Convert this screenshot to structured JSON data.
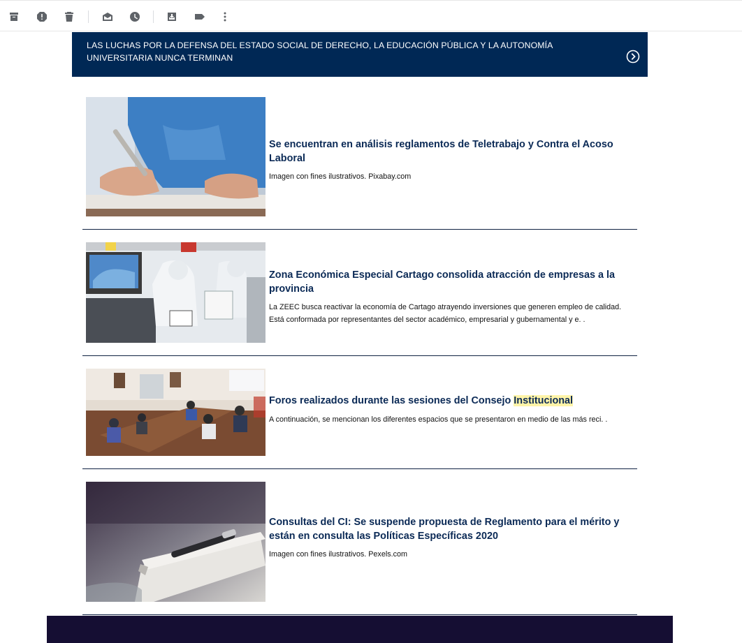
{
  "toolbar": {
    "buttons": [
      {
        "name": "archive-icon"
      },
      {
        "name": "report-spam-icon"
      },
      {
        "name": "delete-icon"
      },
      {
        "name": "mark-unread-icon"
      },
      {
        "name": "snooze-icon"
      },
      {
        "name": "move-to-icon"
      },
      {
        "name": "label-icon"
      },
      {
        "name": "more-options-icon"
      }
    ]
  },
  "banner": {
    "text": "LAS LUCHAS POR LA DEFENSA DEL ESTADO SOCIAL DE DERECHO, LA EDUCACIÓN PÚBLICA Y LA AUTONOMÍA UNIVERSITARIA NUNCA TERMINAN",
    "background": "#002855"
  },
  "articles": [
    {
      "title": "Se encuentran en análisis reglamentos de Teletrabajo y Contra el Acoso Laboral",
      "desc": "Imagen con fines ilustrativos. Pixabay.com",
      "image": "person-signing-document"
    },
    {
      "title": "Zona Económica Especial Cartago consolida atracción de empresas a la provincia",
      "desc": "La ZEEC busca reactivar la economía de Cartago atrayendo inversiones que generen empleo de calidad. Está conformada por representantes del sector académico, empresarial y gubernamental y e. .",
      "image": "laboratory-workers"
    },
    {
      "title_before": "Foros realizados durante las sesiones del Consejo ",
      "title_highlight": "Institucional",
      "desc": "A continuación, se mencionan los diferentes espacios que se presentaron en medio de las más reci. .",
      "image": "council-meeting"
    },
    {
      "title": "Consultas del CI: Se suspende propuesta de Reglamento para el mérito y están en consulta las Políticas Específicas 2020",
      "desc": "Imagen con fines ilustrativos. Pexels.com",
      "image": "notebook-and-pen"
    }
  ],
  "colors": {
    "title": "#0b2a56",
    "divider": "#0f2142",
    "footer": "#150e33",
    "highlight": "#fff4a8"
  }
}
